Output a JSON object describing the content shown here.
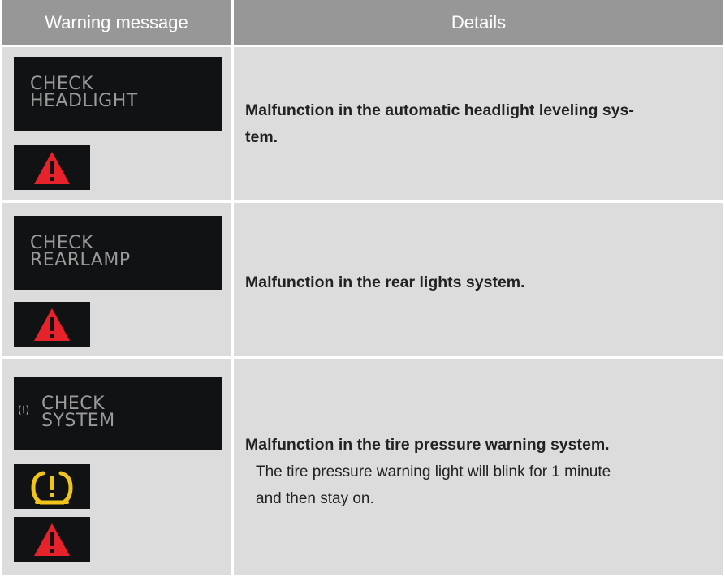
{
  "header": {
    "col1": "Warning message",
    "col2": "Details"
  },
  "rows": [
    {
      "display_line1": "CHECK",
      "display_line2": "HEADLIGHT",
      "icons": [
        "red-triangle-warning-icon"
      ],
      "title_line1": "Malfunction in the automatic headlight leveling sys-",
      "title_line2": "tem."
    },
    {
      "display_line1": "CHECK",
      "display_line2": "REARLAMP",
      "icons": [
        "red-triangle-warning-icon"
      ],
      "title": "Malfunction in the rear lights system."
    },
    {
      "display_symbol": "(!)",
      "display_line1": "CHECK",
      "display_line2": "SYSTEM",
      "icons": [
        "tire-pressure-warning-icon",
        "red-triangle-warning-icon"
      ],
      "title": "Malfunction in the tire pressure warning system.",
      "note_line1": "The tire pressure warning light will blink for 1 minute",
      "note_line2": "and then stay on."
    }
  ],
  "colors": {
    "header_bg": "#979797",
    "cell_bg": "#dcdcdc",
    "display_bg": "#111214",
    "warning_red": "#e8222a",
    "tire_yellow": "#f0c419"
  }
}
